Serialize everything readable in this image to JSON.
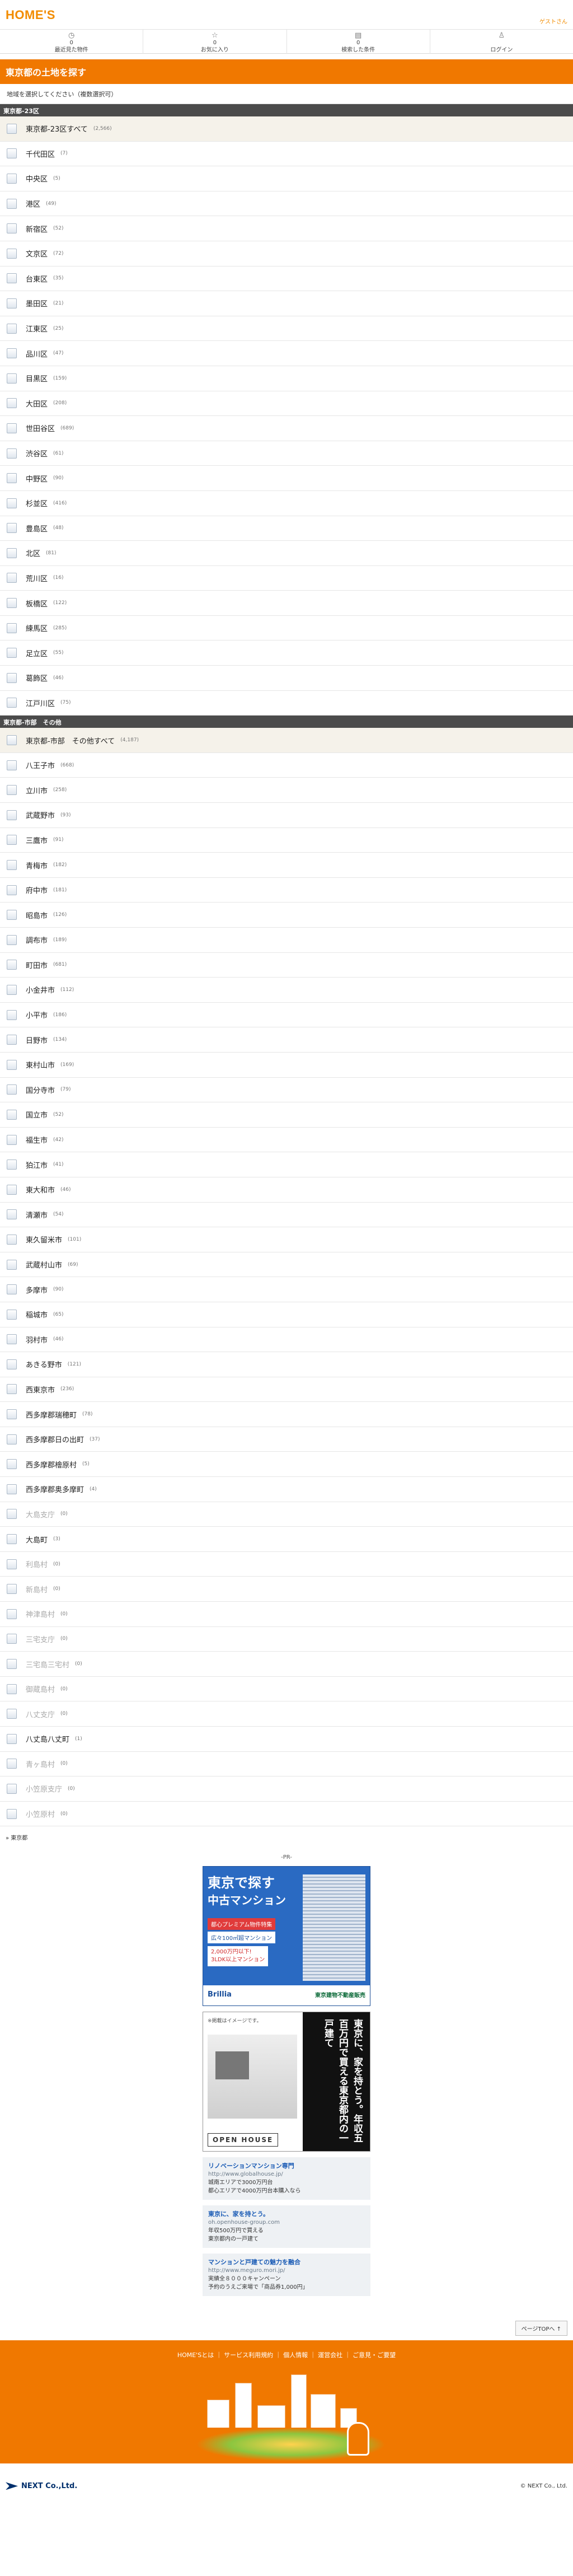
{
  "header": {
    "logo": "HOME'S",
    "guest": "ゲストさん",
    "nav": [
      {
        "icon": "clock-icon",
        "glyph": "◷",
        "count": "0",
        "label": "最近見た物件"
      },
      {
        "icon": "star-icon",
        "glyph": "☆",
        "count": "0",
        "label": "お気に入り"
      },
      {
        "icon": "history-icon",
        "glyph": "▤",
        "count": "0",
        "label": "検索した条件"
      },
      {
        "icon": "user-icon",
        "glyph": "♙",
        "count": "",
        "label": "ログイン"
      }
    ]
  },
  "page": {
    "title": "東京都の土地を探す",
    "instruction": "地域を選択してください（複数選択可）"
  },
  "sections": [
    {
      "title": "東京都-23区",
      "items": [
        {
          "label": "東京都-23区すべて",
          "count": "(2,566)",
          "all": true
        },
        {
          "label": "千代田区",
          "count": "(7)"
        },
        {
          "label": "中央区",
          "count": "(5)"
        },
        {
          "label": "港区",
          "count": "(49)"
        },
        {
          "label": "新宿区",
          "count": "(52)"
        },
        {
          "label": "文京区",
          "count": "(72)"
        },
        {
          "label": "台東区",
          "count": "(35)"
        },
        {
          "label": "墨田区",
          "count": "(21)"
        },
        {
          "label": "江東区",
          "count": "(25)"
        },
        {
          "label": "品川区",
          "count": "(47)"
        },
        {
          "label": "目黒区",
          "count": "(159)"
        },
        {
          "label": "大田区",
          "count": "(208)"
        },
        {
          "label": "世田谷区",
          "count": "(689)"
        },
        {
          "label": "渋谷区",
          "count": "(61)"
        },
        {
          "label": "中野区",
          "count": "(90)"
        },
        {
          "label": "杉並区",
          "count": "(416)"
        },
        {
          "label": "豊島区",
          "count": "(48)"
        },
        {
          "label": "北区",
          "count": "(81)"
        },
        {
          "label": "荒川区",
          "count": "(16)"
        },
        {
          "label": "板橋区",
          "count": "(122)"
        },
        {
          "label": "練馬区",
          "count": "(285)"
        },
        {
          "label": "足立区",
          "count": "(55)"
        },
        {
          "label": "葛飾区",
          "count": "(46)"
        },
        {
          "label": "江戸川区",
          "count": "(75)"
        }
      ]
    },
    {
      "title": "東京都-市部　その他",
      "items": [
        {
          "label": "東京都-市部　その他すべて",
          "count": "(4,187)",
          "all": true
        },
        {
          "label": "八王子市",
          "count": "(668)"
        },
        {
          "label": "立川市",
          "count": "(258)"
        },
        {
          "label": "武蔵野市",
          "count": "(93)"
        },
        {
          "label": "三鷹市",
          "count": "(91)"
        },
        {
          "label": "青梅市",
          "count": "(182)"
        },
        {
          "label": "府中市",
          "count": "(181)"
        },
        {
          "label": "昭島市",
          "count": "(126)"
        },
        {
          "label": "調布市",
          "count": "(189)"
        },
        {
          "label": "町田市",
          "count": "(681)"
        },
        {
          "label": "小金井市",
          "count": "(112)"
        },
        {
          "label": "小平市",
          "count": "(186)"
        },
        {
          "label": "日野市",
          "count": "(134)"
        },
        {
          "label": "東村山市",
          "count": "(169)"
        },
        {
          "label": "国分寺市",
          "count": "(79)"
        },
        {
          "label": "国立市",
          "count": "(52)"
        },
        {
          "label": "福生市",
          "count": "(42)"
        },
        {
          "label": "狛江市",
          "count": "(41)"
        },
        {
          "label": "東大和市",
          "count": "(46)"
        },
        {
          "label": "清瀬市",
          "count": "(54)"
        },
        {
          "label": "東久留米市",
          "count": "(101)"
        },
        {
          "label": "武蔵村山市",
          "count": "(69)"
        },
        {
          "label": "多摩市",
          "count": "(90)"
        },
        {
          "label": "稲城市",
          "count": "(65)"
        },
        {
          "label": "羽村市",
          "count": "(46)"
        },
        {
          "label": "あきる野市",
          "count": "(121)"
        },
        {
          "label": "西東京市",
          "count": "(236)"
        },
        {
          "label": "西多摩郡瑞穂町",
          "count": "(78)"
        },
        {
          "label": "西多摩郡日の出町",
          "count": "(37)"
        },
        {
          "label": "西多摩郡檜原村",
          "count": "(5)"
        },
        {
          "label": "西多摩郡奥多摩町",
          "count": "(4)"
        },
        {
          "label": "大島支庁",
          "count": "(0)",
          "dim": true
        },
        {
          "label": "大島町",
          "count": "(3)"
        },
        {
          "label": "利島村",
          "count": "(0)",
          "dim": true
        },
        {
          "label": "新島村",
          "count": "(0)",
          "dim": true
        },
        {
          "label": "神津島村",
          "count": "(0)",
          "dim": true
        },
        {
          "label": "三宅支庁",
          "count": "(0)",
          "dim": true
        },
        {
          "label": "三宅島三宅村",
          "count": "(0)",
          "dim": true
        },
        {
          "label": "御蔵島村",
          "count": "(0)",
          "dim": true
        },
        {
          "label": "八丈支庁",
          "count": "(0)",
          "dim": true
        },
        {
          "label": "八丈島八丈町",
          "count": "(1)"
        },
        {
          "label": "青ヶ島村",
          "count": "(0)",
          "dim": true
        },
        {
          "label": "小笠原支庁",
          "count": "(0)",
          "dim": true
        },
        {
          "label": "小笠原村",
          "count": "(0)",
          "dim": true
        }
      ]
    }
  ],
  "breadcrumb": "東京都",
  "pr": "-PR-",
  "banner1": {
    "line1": "東京で探す",
    "line2": "中古マンション",
    "tag1": "都心プレミアム物件特集",
    "tag2": "広々100㎡超マンション",
    "price": "2,000万円以下!\n3LDK以上マンション",
    "brand": "Brillia",
    "brand_sub": "東京建物不動産販売"
  },
  "banner2": {
    "small": "※掲載はイメージです。",
    "vertical": "東京に、家を持とう。年収五百万円で買える東京都内の一戸建て",
    "brand": "OPEN HOUSE"
  },
  "text_ads": [
    {
      "title": "リノベーションマンション専門",
      "url": "http://www.globalhouse.jp/",
      "lines": [
        "城南エリアで3000万円台",
        "都心エリアで4000万円台本購入なら"
      ]
    },
    {
      "title": "東京に、家を持とう。",
      "url": "oh.openhouse-group.com",
      "lines": [
        "年収500万円で買える",
        "東京都内の一戸建て"
      ]
    },
    {
      "title": "マンションと戸建ての魅力を融合",
      "url": "http://www.meguro.mori.jp/",
      "lines": [
        "実績全８０００キャンペーン",
        "予約のうえご来場で「商品券1,000円」"
      ]
    }
  ],
  "pagetop": "ページTOPへ ↑",
  "footer": {
    "links": "HOME'Sとは ｜ サービス利用規約 ｜ 個人情報 ｜ 運営会社 ｜ ご意見・ご要望",
    "company": "NEXT Co.,Ltd.",
    "copyright": "© NEXT Co., Ltd."
  }
}
